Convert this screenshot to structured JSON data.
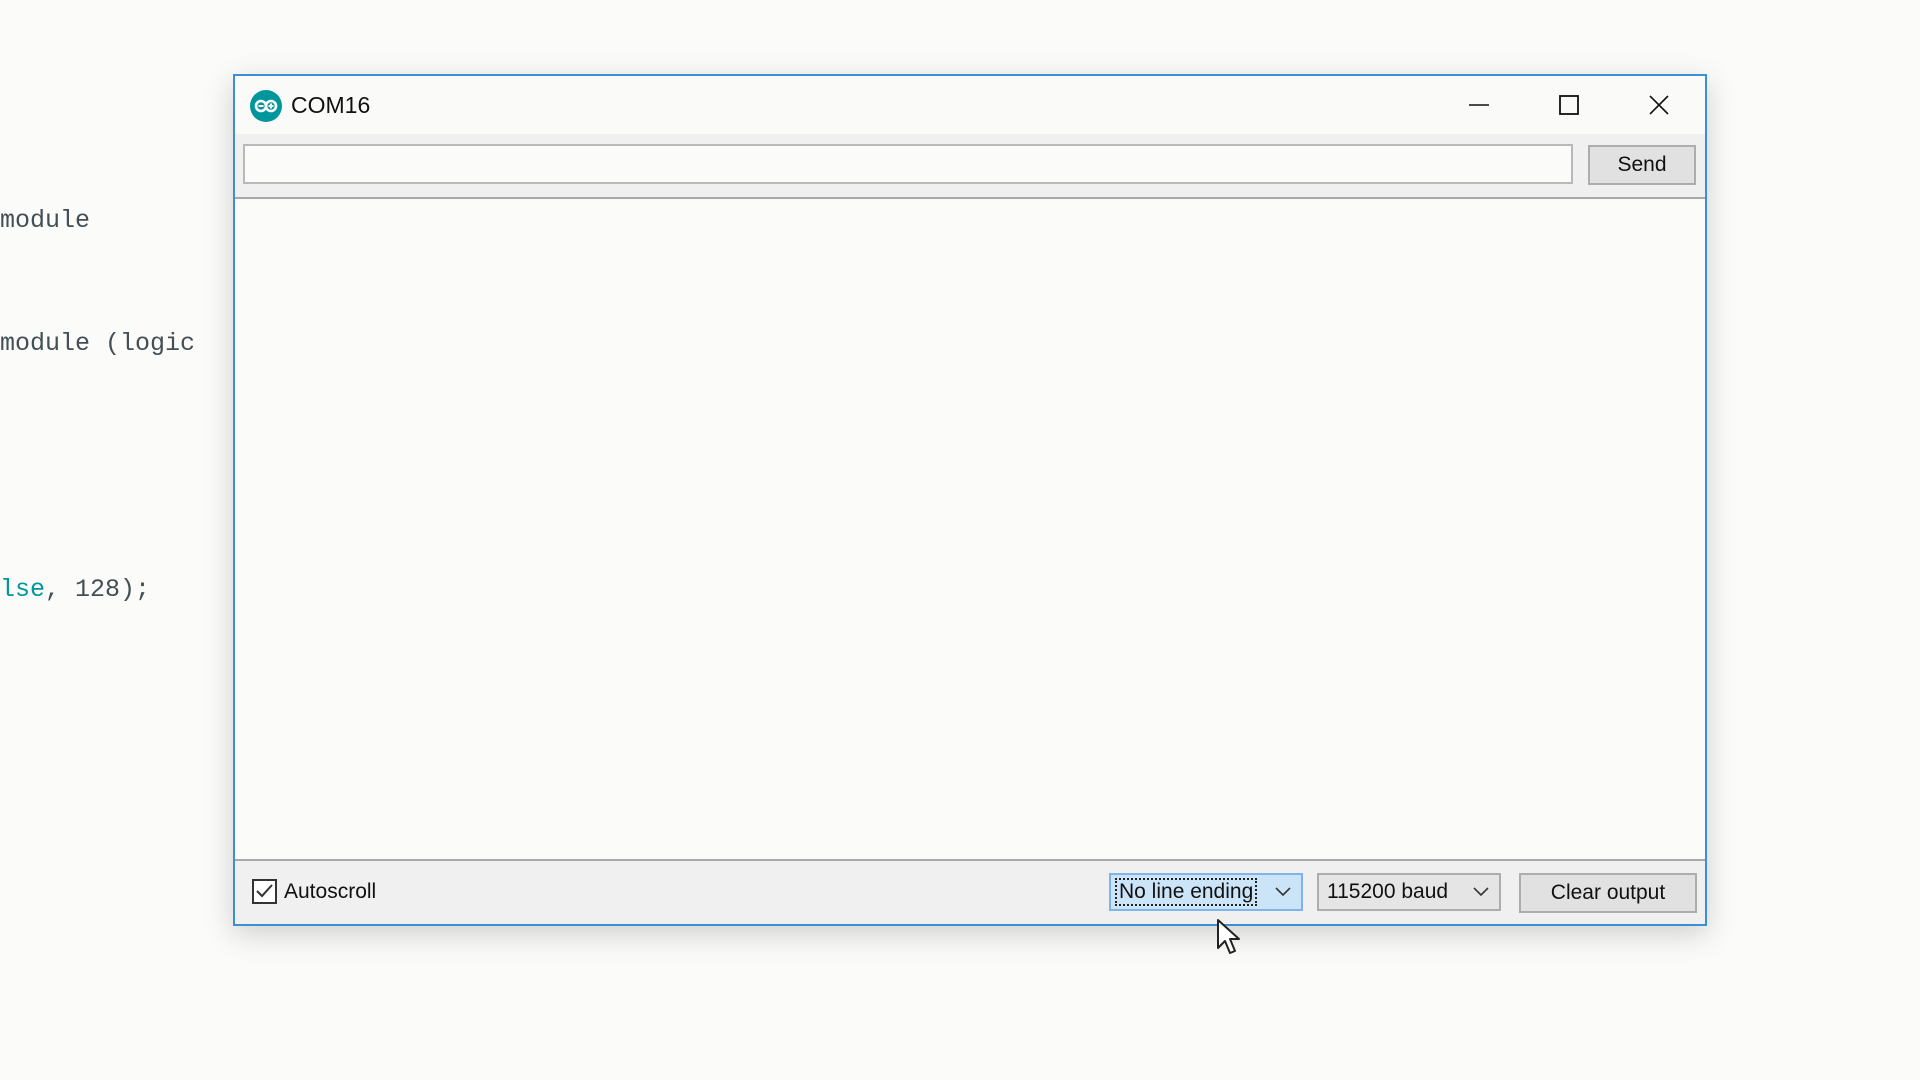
{
  "background_editor": {
    "lines": [
      {
        "text": "module"
      },
      {
        "text": "module (logic"
      },
      {
        "text": ""
      },
      {
        "text_teal": "lse",
        "text_rest": ", 128);"
      }
    ]
  },
  "window": {
    "title": "COM16",
    "app_icon": "arduino-logo-icon",
    "controls": {
      "minimize": "minimize-icon",
      "maximize": "maximize-icon",
      "close": "close-icon"
    }
  },
  "send_row": {
    "input_value": "",
    "send_label": "Send"
  },
  "output": {
    "text": ""
  },
  "bottom_bar": {
    "autoscroll_label": "Autoscroll",
    "autoscroll_checked": true,
    "line_ending_selected": "No line ending",
    "baud_selected": "115200 baud",
    "clear_label": "Clear output"
  },
  "colors": {
    "accent": "#00979c",
    "window_border": "#3c8fd6",
    "focus_bg": "#cce4f7"
  }
}
